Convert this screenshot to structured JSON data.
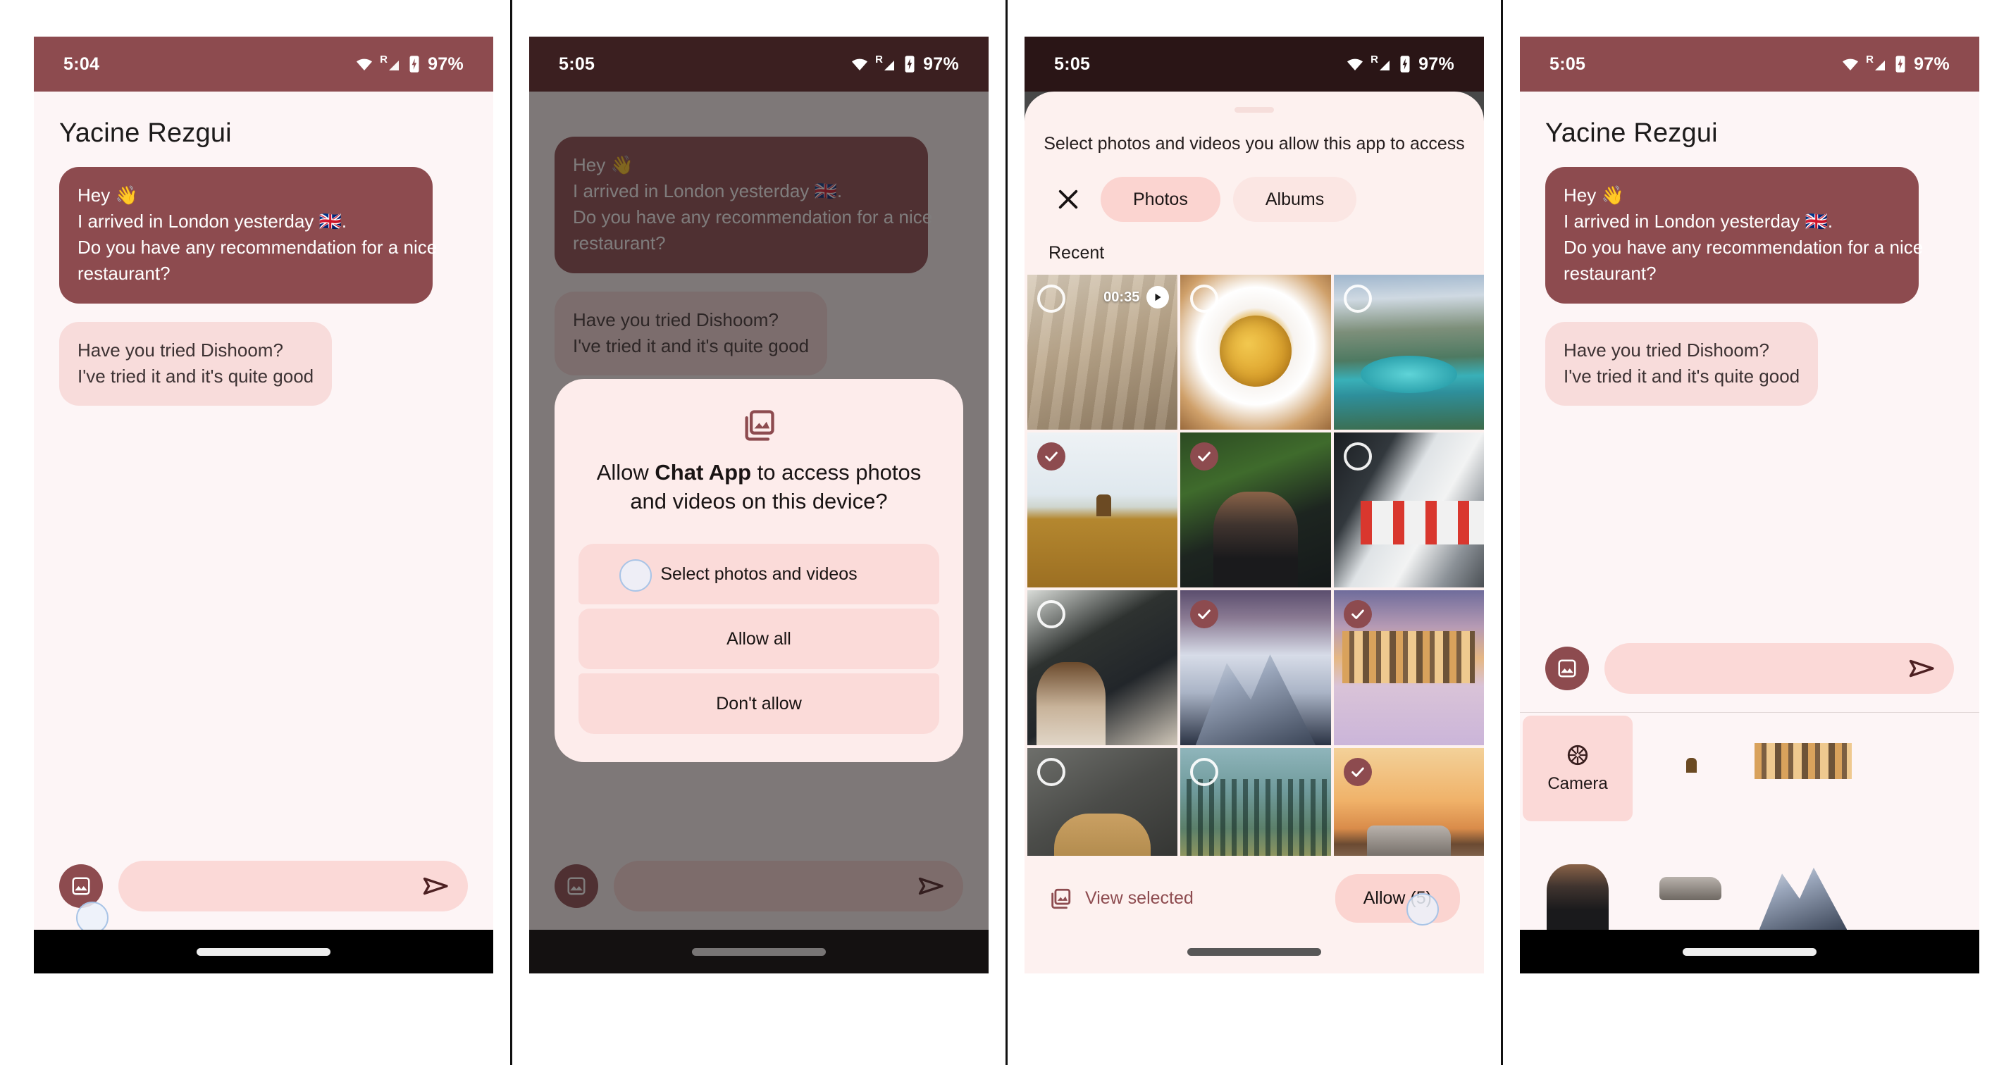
{
  "frames": [
    {
      "id": "chat-initial",
      "status": {
        "time": "5:04",
        "battery": "97%",
        "roaming": "R",
        "theme": "maroon"
      },
      "chat": {
        "title": "Yacine Rezgui",
        "messages": [
          {
            "dir": "out",
            "lines": [
              "Hey 👋",
              "I arrived in London yesterday 🇬🇧.",
              "Do you have any recommendation for a nice",
              "restaurant?"
            ]
          },
          {
            "dir": "in",
            "lines": [
              "Have you tried Dishoom?",
              "I've tried it and it's quite good"
            ]
          }
        ]
      },
      "composer": {
        "attach_icon": "image-icon",
        "send_icon": "send-icon",
        "input_value": "",
        "input_placeholder": ""
      }
    },
    {
      "id": "permission-dialog",
      "status": {
        "time": "5:05",
        "battery": "97%",
        "roaming": "R",
        "theme": "dark"
      },
      "dialog": {
        "icon": "photo-library-icon",
        "title_pre": "Allow ",
        "title_app": "Chat App",
        "title_post": " to access photos and videos on this device?",
        "options": [
          {
            "label": "Select photos and videos",
            "tapped": true
          },
          {
            "label": "Allow all",
            "tapped": false
          },
          {
            "label": "Don't allow",
            "tapped": false
          }
        ]
      }
    },
    {
      "id": "photo-picker",
      "status": {
        "time": "5:05",
        "battery": "97%",
        "roaming": "R",
        "theme": "darker"
      },
      "picker": {
        "subtitle": "Select photos and videos you allow this app to access",
        "close_icon": "close-icon",
        "tabs": [
          {
            "label": "Photos",
            "selected": true
          },
          {
            "label": "Albums",
            "selected": false
          }
        ],
        "section": "Recent",
        "items": [
          {
            "art": "ph-floor",
            "name": "video-floor",
            "selected": false,
            "video": true,
            "duration": "00:35"
          },
          {
            "art": "ph-pasta",
            "name": "photo-pasta",
            "selected": false,
            "video": false,
            "duration": ""
          },
          {
            "art": "ph-lake",
            "name": "photo-lake",
            "selected": false,
            "video": false,
            "duration": ""
          },
          {
            "art": "ph-field",
            "name": "photo-field",
            "selected": true,
            "video": false,
            "duration": ""
          },
          {
            "art": "ph-couple",
            "name": "photo-couple",
            "selected": true,
            "video": false,
            "duration": ""
          },
          {
            "art": "ph-train",
            "name": "photo-train",
            "selected": false,
            "video": false,
            "duration": ""
          },
          {
            "art": "ph-cabin",
            "name": "photo-cabin",
            "selected": false,
            "video": false,
            "duration": ""
          },
          {
            "art": "ph-mtn",
            "name": "photo-mountain",
            "selected": true,
            "video": false,
            "duration": ""
          },
          {
            "art": "ph-city",
            "name": "photo-city",
            "selected": true,
            "video": false,
            "duration": ""
          },
          {
            "art": "ph-man",
            "name": "photo-man",
            "selected": false,
            "video": false,
            "duration": ""
          },
          {
            "art": "ph-forest",
            "name": "photo-forest",
            "selected": false,
            "video": false,
            "duration": ""
          },
          {
            "art": "ph-car",
            "name": "photo-car",
            "selected": true,
            "video": false,
            "duration": ""
          }
        ],
        "view_selected_label": "View selected",
        "view_selected_icon": "photo-library-icon",
        "allow_label": "Allow (5)"
      }
    },
    {
      "id": "chat-with-tray",
      "status": {
        "time": "5:05",
        "battery": "97%",
        "roaming": "R",
        "theme": "maroon"
      },
      "chat": {
        "title": "Yacine Rezgui",
        "messages": [
          {
            "dir": "out",
            "lines": [
              "Hey 👋",
              "I arrived in London yesterday 🇬🇧.",
              "Do you have any recommendation for a nice",
              "restaurant?"
            ]
          },
          {
            "dir": "in",
            "lines": [
              "Have you tried Dishoom?",
              "I've tried it and it's quite good"
            ]
          }
        ]
      },
      "composer": {
        "attach_icon": "image-icon",
        "send_icon": "send-icon",
        "input_value": "",
        "input_placeholder": ""
      },
      "tray": {
        "camera_label": "Camera",
        "camera_icon": "camera-aperture-icon",
        "row1": [
          "ph-field",
          "ph-city"
        ],
        "row2": [
          "ph-couple",
          "ph-car",
          "ph-mtn"
        ]
      }
    }
  ],
  "colors": {
    "brand_maroon": "#8d4b4f",
    "status_dark": "#3b1f20",
    "status_darker": "#2a1516",
    "surface": "#fdf5f6",
    "bubble_in": "#f8dcdb",
    "pill": "#fbd9d7",
    "tab_selected": "#fbd4d0",
    "tab_unselected": "#fbe6e3"
  }
}
